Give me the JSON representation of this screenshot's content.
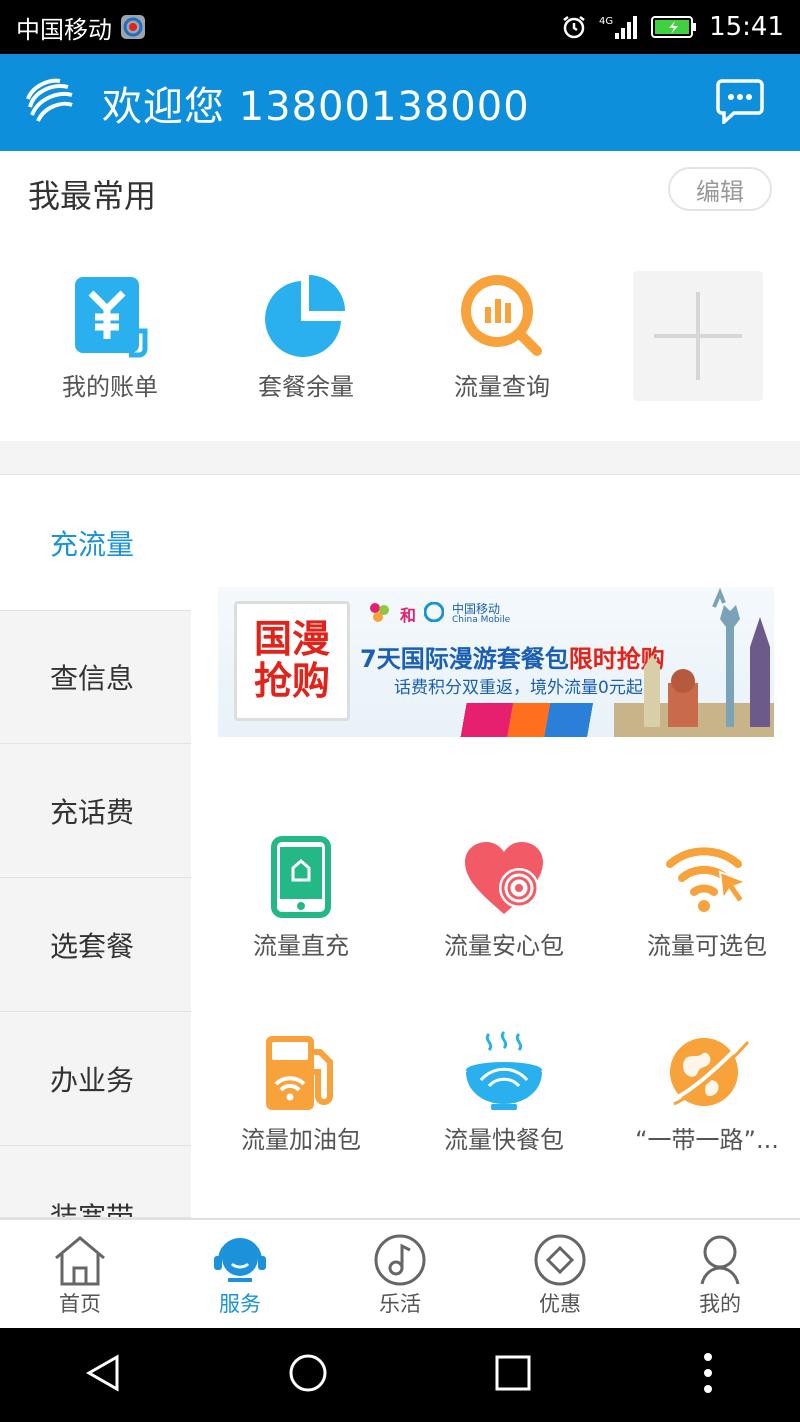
{
  "status_bar": {
    "carrier": "中国移动",
    "network": "4G",
    "time": "15:41"
  },
  "header": {
    "welcome": "欢迎您 13800138000",
    "accent_color": "#0e8fdc"
  },
  "favorites": {
    "title": "我最常用",
    "edit_label": "编辑",
    "items": [
      {
        "label": "我的账单",
        "icon": "bill-icon",
        "color": "#2ab0ee"
      },
      {
        "label": "套餐余量",
        "icon": "pie-chart-icon",
        "color": "#2ab0ee"
      },
      {
        "label": "流量查询",
        "icon": "data-query-icon",
        "color": "#f7a23b"
      }
    ],
    "add_icon": "plus-icon"
  },
  "sidebar": {
    "items": [
      {
        "label": "充流量",
        "active": true
      },
      {
        "label": "查信息",
        "active": false
      },
      {
        "label": "充话费",
        "active": false
      },
      {
        "label": "选套餐",
        "active": false
      },
      {
        "label": "办业务",
        "active": false
      },
      {
        "label": "装宽带",
        "active": false
      }
    ]
  },
  "banner": {
    "badge_line1": "国漫",
    "badge_line2": "抢购",
    "brand_and": "和",
    "brand_cm": "中国移动",
    "brand_cm_en": "China Mobile",
    "headline_prefix": "7天国际漫游套餐包",
    "headline_highlight": "限时抢购",
    "subline": "话费积分双重返，境外流量0元起"
  },
  "services": [
    {
      "label": "流量直充",
      "icon": "phone-recharge-icon"
    },
    {
      "label": "流量安心包",
      "icon": "heart-wifi-icon"
    },
    {
      "label": "流量可选包",
      "icon": "wifi-cursor-icon"
    },
    {
      "label": "流量加油包",
      "icon": "fuel-pump-icon"
    },
    {
      "label": "流量快餐包",
      "icon": "bowl-icon"
    },
    {
      "label": "“一带一路”...",
      "icon": "globe-icon"
    }
  ],
  "tabbar": {
    "tabs": [
      {
        "label": "首页",
        "icon": "home-icon",
        "active": false
      },
      {
        "label": "服务",
        "icon": "service-icon",
        "active": true
      },
      {
        "label": "乐活",
        "icon": "music-icon",
        "active": false
      },
      {
        "label": "优惠",
        "icon": "coupon-icon",
        "active": false
      },
      {
        "label": "我的",
        "icon": "user-icon",
        "active": false
      }
    ]
  }
}
